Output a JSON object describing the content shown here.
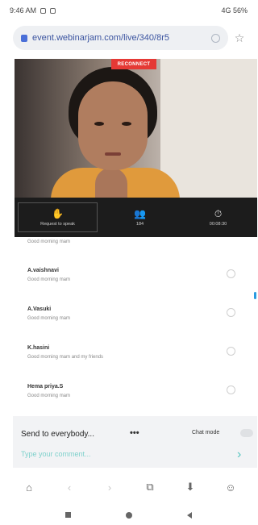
{
  "status_bar": {
    "time": "9:46 AM",
    "right": "4G 56%"
  },
  "browser": {
    "url": "event.webinarjam.com/live/340/8r5",
    "bookmark_icon": "star-icon"
  },
  "video": {
    "badge": "RECONNECT"
  },
  "controls": [
    {
      "icon": "hand-icon",
      "glyph": "✋",
      "label": "Request to speak"
    },
    {
      "icon": "people-icon",
      "glyph": "👥",
      "label": "184"
    },
    {
      "icon": "clock-icon",
      "glyph": "⏱",
      "label": "00:08:30"
    }
  ],
  "chat": {
    "previous_text": "Good morning mam",
    "messages": [
      {
        "name": "A.vaishnavi",
        "text": "Good morning mam"
      },
      {
        "name": "A.Vasuki",
        "text": "Good morning mam"
      },
      {
        "name": "K.hasini",
        "text": "Good morning mam and my friends"
      },
      {
        "name": "Hema priya.S",
        "text": "Good morning mam"
      }
    ]
  },
  "compose": {
    "send_to": "Send to everybody...",
    "more": "•••",
    "chat_mode": "Chat mode",
    "placeholder": "Type your comment...",
    "accent": "#58c6c1"
  },
  "browser_nav": [
    {
      "icon": "home-icon",
      "glyph": "⌂"
    },
    {
      "icon": "back-icon",
      "glyph": "‹"
    },
    {
      "icon": "forward-icon",
      "glyph": "›"
    },
    {
      "icon": "tabs-icon",
      "glyph": "⧉"
    },
    {
      "icon": "download-icon",
      "glyph": "⬇"
    },
    {
      "icon": "profile-icon",
      "glyph": "☺"
    }
  ]
}
